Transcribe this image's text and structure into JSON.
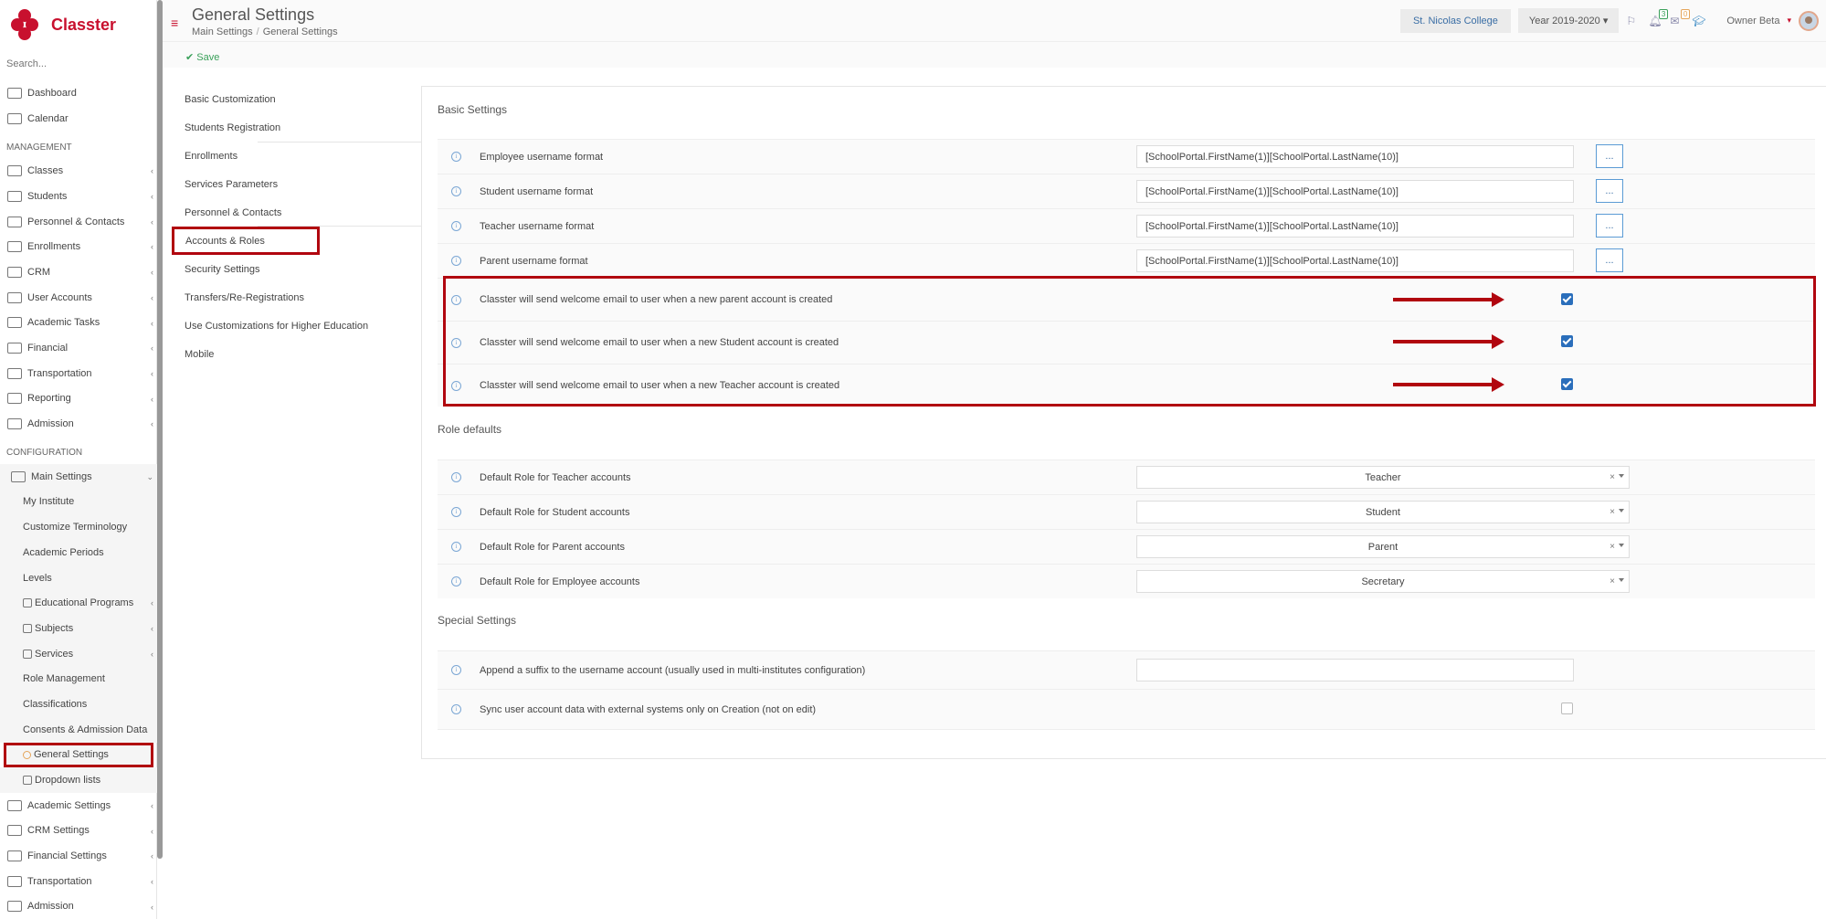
{
  "app": {
    "name": "Classter"
  },
  "sidebar": {
    "search_placeholder": "Search...",
    "top_items": [
      {
        "label": "Dashboard",
        "icon": "laptop-icon"
      },
      {
        "label": "Calendar",
        "icon": "calendar-icon"
      }
    ],
    "management_heading": "MANAGEMENT",
    "management_items": [
      {
        "label": "Classes",
        "icon": "classes-icon"
      },
      {
        "label": "Students",
        "icon": "students-icon"
      },
      {
        "label": "Personnel & Contacts",
        "icon": "personnel-icon"
      },
      {
        "label": "Enrollments",
        "icon": "enrollments-icon"
      },
      {
        "label": "CRM",
        "icon": "crm-icon"
      },
      {
        "label": "User Accounts",
        "icon": "key-icon"
      },
      {
        "label": "Academic Tasks",
        "icon": "tasks-icon"
      },
      {
        "label": "Financial",
        "icon": "financial-icon"
      },
      {
        "label": "Transportation",
        "icon": "bus-icon"
      },
      {
        "label": "Reporting",
        "icon": "print-icon"
      },
      {
        "label": "Admission",
        "icon": "bank-icon"
      }
    ],
    "configuration_heading": "CONFIGURATION",
    "main_settings": {
      "label": "Main Settings",
      "icon": "sliders-icon"
    },
    "main_settings_items": [
      {
        "label": "My Institute"
      },
      {
        "label": "Customize Terminology"
      },
      {
        "label": "Academic Periods"
      },
      {
        "label": "Levels"
      },
      {
        "label": "Educational Programs"
      },
      {
        "label": "Subjects"
      },
      {
        "label": "Services"
      },
      {
        "label": "Role Management"
      },
      {
        "label": "Classifications"
      },
      {
        "label": "Consents & Admission Data"
      },
      {
        "label": "General Settings"
      },
      {
        "label": "Dropdown lists"
      }
    ],
    "config_items": [
      {
        "label": "Academic Settings",
        "icon": "academic-icon"
      },
      {
        "label": "CRM Settings",
        "icon": "crm-icon"
      },
      {
        "label": "Financial Settings",
        "icon": "financial-icon"
      },
      {
        "label": "Transportation",
        "icon": "bus-icon"
      },
      {
        "label": "Admission",
        "icon": "bank-icon"
      }
    ]
  },
  "header": {
    "title": "General Settings",
    "breadcrumb": [
      "Main Settings",
      "General Settings"
    ],
    "college": "St. Nicolas College",
    "year": "Year 2019-2020",
    "notifications_count": "3",
    "messages_count": "0",
    "user": "Owner Beta"
  },
  "toolbar": {
    "save_label": "Save"
  },
  "settings_menu": [
    "Basic Customization",
    "Students Registration",
    "Enrollments",
    "Services Parameters",
    "Personnel & Contacts",
    "Accounts & Roles",
    "Security Settings",
    "Transfers/Re-Registrations",
    "Use Customizations for Higher Education",
    "Mobile"
  ],
  "basic_settings": {
    "title": "Basic Settings",
    "formats": [
      {
        "label": "Employee username format",
        "value": "[SchoolPortal.FirstName(1)][SchoolPortal.LastName(10)]"
      },
      {
        "label": "Student username format",
        "value": "[SchoolPortal.FirstName(1)][SchoolPortal.LastName(10)]"
      },
      {
        "label": "Teacher username format",
        "value": "[SchoolPortal.FirstName(1)][SchoolPortal.LastName(10)]"
      },
      {
        "label": "Parent username format",
        "value": "[SchoolPortal.FirstName(1)][SchoolPortal.LastName(10)]"
      }
    ],
    "dots_label": "...",
    "welcome": [
      {
        "label": "Classter will send welcome email to user when a new parent account is created",
        "checked": true
      },
      {
        "label": "Classter will send welcome email to user when a new Student account is created",
        "checked": true
      },
      {
        "label": "Classter will send welcome email to user when a new Teacher account is created",
        "checked": true
      }
    ]
  },
  "role_defaults": {
    "title": "Role defaults",
    "rows": [
      {
        "label": "Default Role for Teacher accounts",
        "value": "Teacher"
      },
      {
        "label": "Default Role for Student accounts",
        "value": "Student"
      },
      {
        "label": "Default Role for Parent accounts",
        "value": "Parent"
      },
      {
        "label": "Default Role for Employee accounts",
        "value": "Secretary"
      }
    ],
    "clear_symbol": "×"
  },
  "special_settings": {
    "title": "Special Settings",
    "suffix_label": "Append a suffix to the username account (usually used in multi-institutes configuration)",
    "suffix_value": "",
    "sync_label": "Sync user account data with external systems only on Creation (not on edit)",
    "sync_checked": false
  },
  "colors": {
    "brand": "#c8102e",
    "highlight": "#b1060f",
    "accent_blue": "#2a6ebb",
    "save_green": "#3aa05a"
  }
}
